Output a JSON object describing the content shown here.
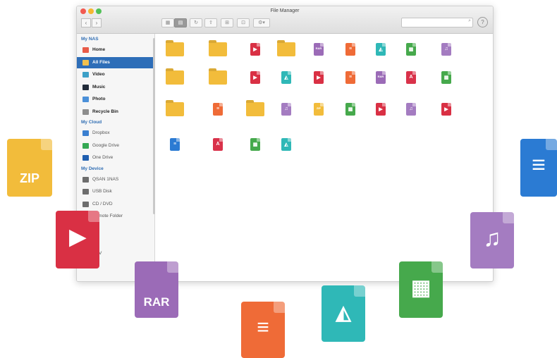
{
  "window": {
    "title": "File Manager",
    "search_icon": "magnifier-icon",
    "help_icon": "question-circle-icon"
  },
  "toolbar": {
    "back_icon": "chevron-left-icon",
    "forward_icon": "chevron-right-icon",
    "buttons": [
      "grid-view-icon",
      "list-view-icon",
      "refresh-icon",
      "upload-icon",
      "new-folder-icon",
      "new-file-icon",
      "settings-icon"
    ]
  },
  "sidebar": {
    "sections": [
      {
        "title": "My NAS",
        "items": [
          {
            "label": "Home",
            "icon": "home-icon",
            "color": "#e85b48"
          },
          {
            "label": "All Files",
            "icon": "folder-icon",
            "color": "#f2c14e",
            "selected": true
          },
          {
            "label": "Video",
            "icon": "video-icon",
            "color": "#3da0c7"
          },
          {
            "label": "Music",
            "icon": "music-icon",
            "color": "#222c3a"
          },
          {
            "label": "Photo",
            "icon": "photo-icon",
            "color": "#4b90d9"
          },
          {
            "label": "Recycle Bin",
            "icon": "trash-icon",
            "color": "#8d8d8d"
          }
        ]
      },
      {
        "title": "My Cloud",
        "items": [
          {
            "label": "Dropbox",
            "icon": "dropbox-icon",
            "color": "#3a7fd0"
          },
          {
            "label": "Google Drive",
            "icon": "google-drive-icon",
            "color": "#34a853"
          },
          {
            "label": "One Drive",
            "icon": "onedrive-icon",
            "color": "#1f5fb0"
          }
        ]
      },
      {
        "title": "My Device",
        "items": [
          {
            "label": "QSAN 1NAS",
            "icon": "nas-icon",
            "color": "#6d6d6d"
          },
          {
            "label": "USB Disk",
            "icon": "usb-icon",
            "color": "#6d6d6d"
          },
          {
            "label": "CD / DVD",
            "icon": "disc-icon",
            "color": "#6d6d6d"
          },
          {
            "label": "Remote Folder",
            "icon": "remote-folder-icon",
            "color": "#6d6d6d"
          },
          {
            "label": "",
            "icon": "device-icon",
            "color": "#6d6d6d"
          },
          {
            "label": "",
            "icon": "device-icon",
            "color": "#6d6d6d"
          },
          {
            "label": "DEV",
            "icon": "device-icon",
            "color": "#6d6d6d"
          }
        ]
      }
    ]
  },
  "files": [
    [
      "folder",
      "folder",
      "video",
      "zip-folder",
      "rar",
      "ppt",
      "image",
      "sheet",
      "music"
    ],
    [
      "zip-folder",
      "zip-folder",
      "video",
      "image",
      "video",
      "ppt",
      "rar",
      "pdf",
      "sheet"
    ],
    [
      "zip-folder",
      "ppt",
      "zip-folder",
      "music",
      "zip",
      "sheet",
      "video",
      "music",
      "video"
    ],
    [
      "doc",
      "pdf",
      "sheet",
      "image"
    ]
  ],
  "file_styles": {
    "folder": {
      "color": "#f2bc3b",
      "label": ""
    },
    "zip-folder": {
      "color": "#f2bc3b",
      "label": ""
    },
    "video": {
      "color": "#d93044",
      "label": "▶"
    },
    "rar": {
      "color": "#9b6bb7",
      "label": "RAR"
    },
    "ppt": {
      "color": "#ef6b37",
      "label": "≡"
    },
    "image": {
      "color": "#2fb8b7",
      "label": "◭"
    },
    "sheet": {
      "color": "#46a94c",
      "label": "▦"
    },
    "music": {
      "color": "#a47cc1",
      "label": "♫"
    },
    "pdf": {
      "color": "#d9324a",
      "label": "A"
    },
    "zip": {
      "color": "#f2bc3b",
      "label": "ZIP"
    },
    "doc": {
      "color": "#2b7bd3",
      "label": "≡"
    }
  },
  "floating": [
    {
      "type": "zip",
      "label": "ZIP",
      "color": "#f2bc3b"
    },
    {
      "type": "video",
      "label": "▶",
      "color": "#d93044"
    },
    {
      "type": "rar",
      "label": "RAR",
      "color": "#9b6bb7"
    },
    {
      "type": "ppt",
      "label": "≡",
      "color": "#ef6b37"
    },
    {
      "type": "image",
      "label": "◭",
      "color": "#2fb8b7"
    },
    {
      "type": "sheet",
      "label": "▦",
      "color": "#46a94c"
    },
    {
      "type": "music",
      "label": "♫",
      "color": "#a47cc1"
    },
    {
      "type": "doc",
      "label": "≡",
      "color": "#2b7bd3"
    }
  ]
}
